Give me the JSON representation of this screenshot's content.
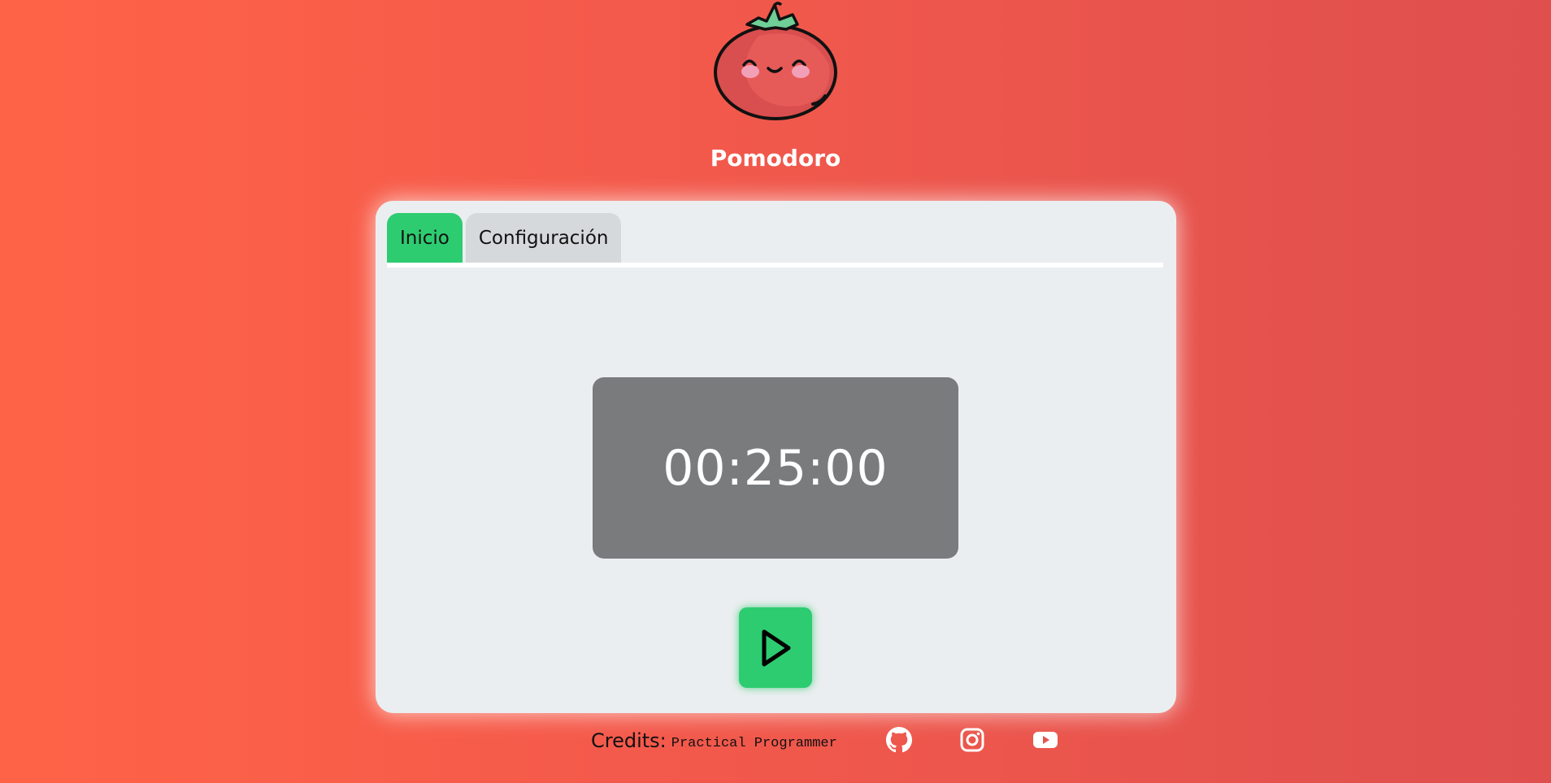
{
  "app": {
    "title": "Pomodoro"
  },
  "tabs": [
    {
      "label": "Inicio",
      "active": true
    },
    {
      "label": "Configuración",
      "active": false
    }
  ],
  "timer": {
    "display": "00:25:00"
  },
  "controls": {
    "play_icon": "play-icon"
  },
  "footer": {
    "credits_label": "Credits:",
    "credits_author": "Practical Programmer",
    "social_icons": [
      "github-icon",
      "instagram-icon",
      "youtube-icon"
    ]
  },
  "colors": {
    "background_start": "#ff6347",
    "background_end": "#df4f4e",
    "accent_green": "#2ecc71",
    "card": "#ebeef0",
    "timer_box": "#7a7b7d"
  }
}
